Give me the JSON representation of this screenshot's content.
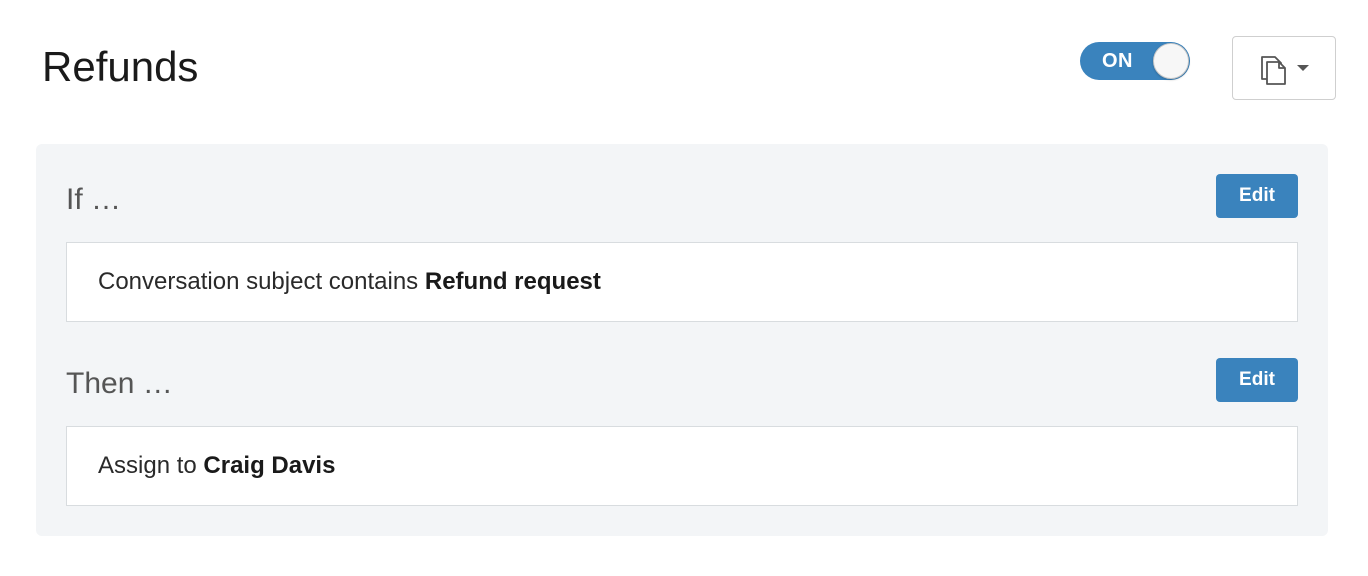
{
  "header": {
    "title": "Refunds",
    "toggle": {
      "label": "ON",
      "state": "on"
    },
    "copy_menu": {
      "icon": "copy-icon",
      "caret_icon": "caret-down-icon"
    }
  },
  "rule": {
    "if_section": {
      "heading": "If …",
      "edit_label": "Edit",
      "condition": {
        "prefix": "Conversation subject contains ",
        "value": "Refund request"
      }
    },
    "then_section": {
      "heading": "Then …",
      "edit_label": "Edit",
      "action": {
        "prefix": "Assign to ",
        "value": "Craig Davis"
      }
    }
  },
  "colors": {
    "accent": "#3a83bd",
    "panel_bg": "#f3f5f7",
    "box_border": "#d8dcdf"
  }
}
